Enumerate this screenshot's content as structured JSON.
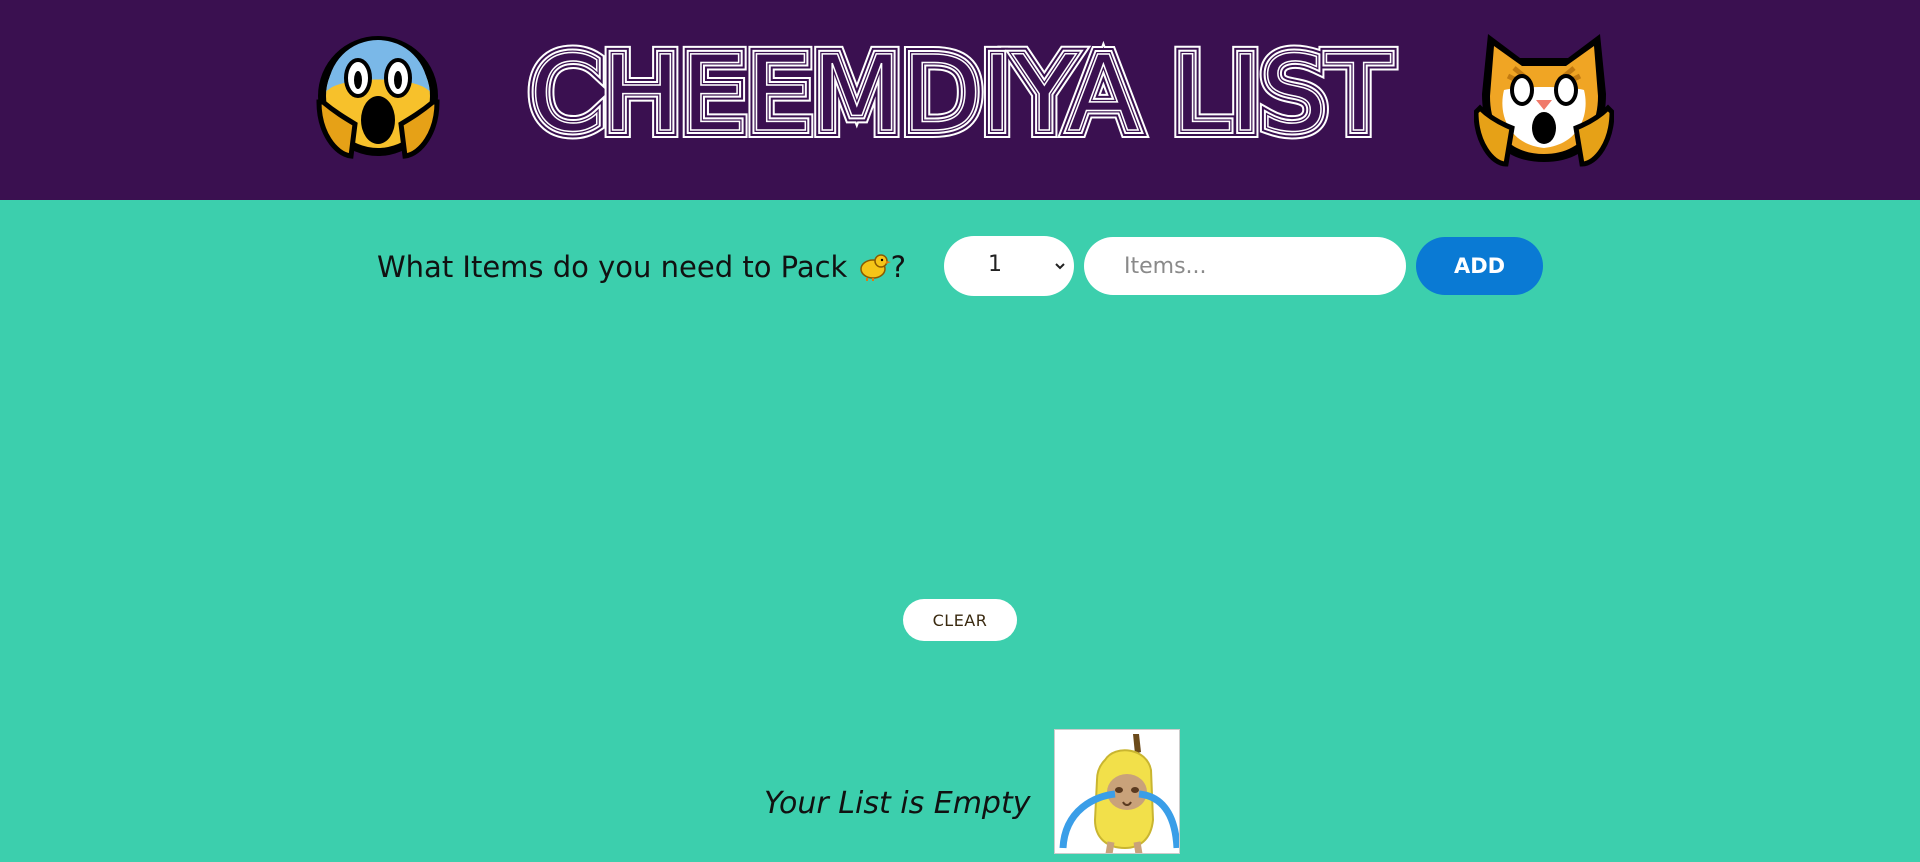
{
  "header": {
    "title": "CHEEMDIYA LIST",
    "left_icon": "face-screaming-in-fear-icon",
    "right_icon": "weary-cat-icon",
    "background": "#3a1050"
  },
  "form": {
    "question_text": "What Items do you need to Pack",
    "question_suffix": "?",
    "question_icon": "chick-icon",
    "quantity_selected": "1",
    "items_placeholder": "Items...",
    "add_label": "ADD",
    "accent_color": "#0a7ad4"
  },
  "actions": {
    "clear_label": "CLEAR"
  },
  "empty_state": {
    "message": "Your List is Empty",
    "image_icon": "crying-banana-cat-icon"
  },
  "colors": {
    "page_background": "#3ccfad"
  }
}
